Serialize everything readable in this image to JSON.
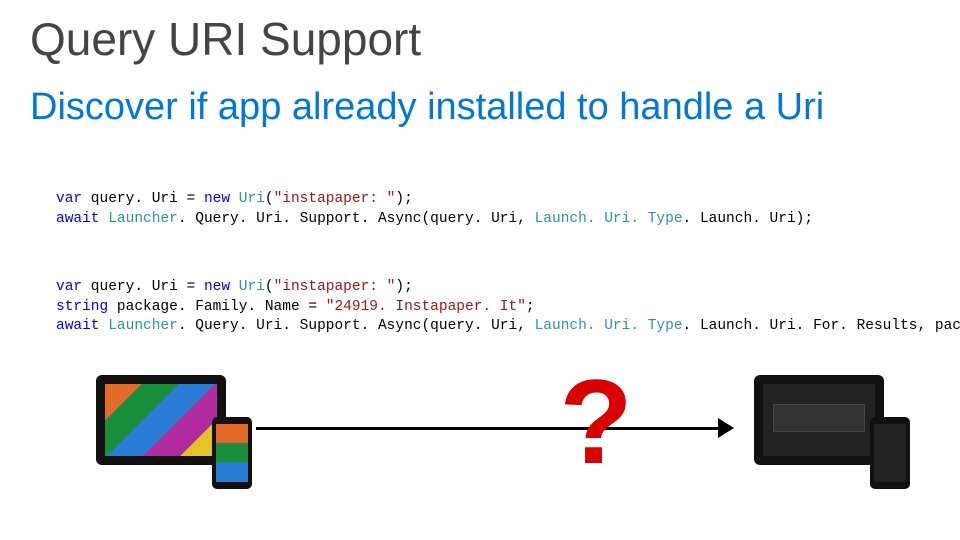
{
  "title": "Query URI Support",
  "subtitle": "Discover if app already installed to handle a Uri",
  "code1": {
    "l1_a": "var",
    "l1_b": " query. Uri = ",
    "l1_c": "new",
    "l1_d": " ",
    "l1_e": "Uri",
    "l1_f": "(",
    "l1_g": "\"instapaper: \"",
    "l1_h": ");",
    "l2_a": "await",
    "l2_b": " ",
    "l2_c": "Launcher",
    "l2_d": ". Query. Uri. Support. Async(query. Uri, ",
    "l2_e": "Launch. Uri. Type",
    "l2_f": ". Launch. Uri);"
  },
  "code2": {
    "l1_a": "var",
    "l1_b": " query. Uri = ",
    "l1_c": "new",
    "l1_d": " ",
    "l1_e": "Uri",
    "l1_f": "(",
    "l1_g": "\"instapaper: \"",
    "l1_h": ");",
    "l2_a": "string",
    "l2_b": " package. Family. Name = ",
    "l2_c": "\"24919. Instapaper. It\"",
    "l2_d": ";",
    "l3_a": "await",
    "l3_b": " ",
    "l3_c": "Launcher",
    "l3_d": ". Query. Uri. Support. Async(query. Uri, ",
    "l3_e": "Launch. Uri. Type",
    "l3_f": ". Launch. Uri. For. Results, package. Family. Name);"
  },
  "diagram": {
    "question": "?"
  }
}
